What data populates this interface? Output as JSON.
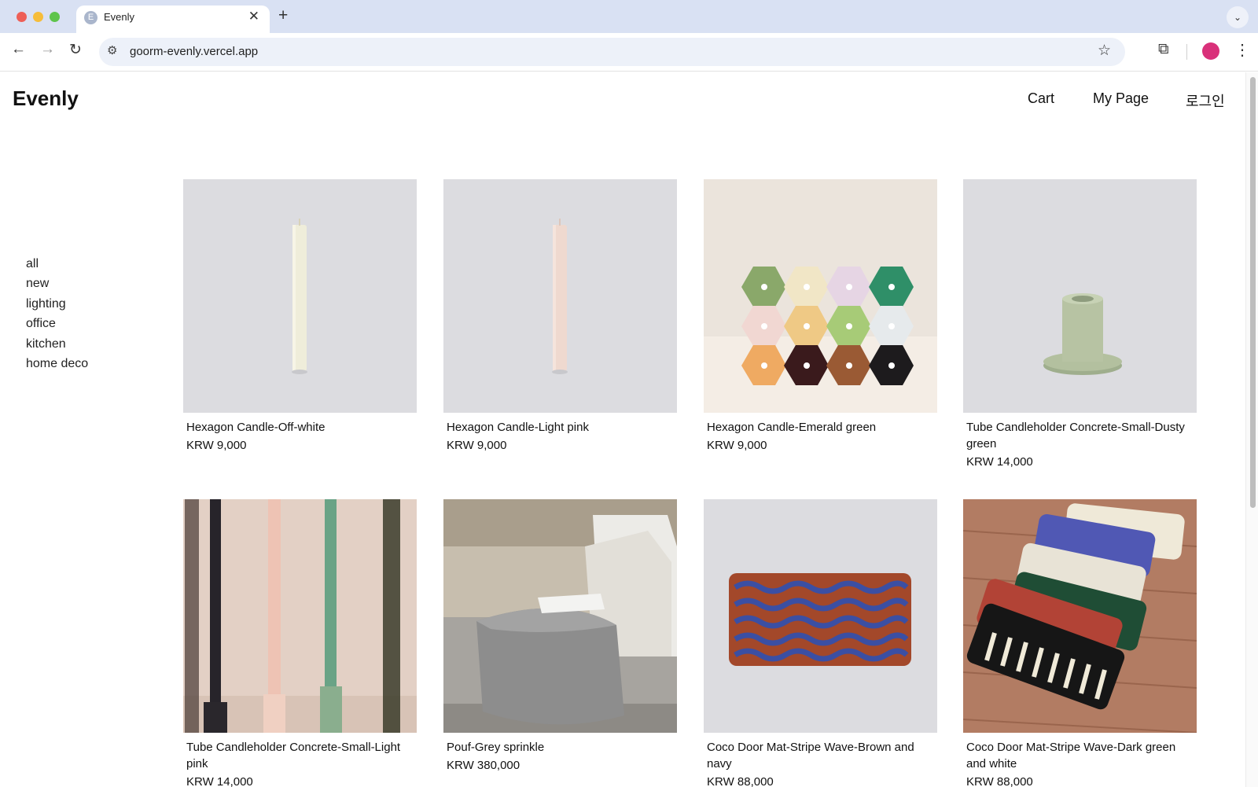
{
  "browser": {
    "tab_title": "Evenly",
    "tab_favicon_letter": "E",
    "url": "goorm-evenly.vercel.app"
  },
  "header": {
    "logo": "Evenly",
    "nav": {
      "cart": "Cart",
      "my_page": "My Page",
      "login": "로그인"
    }
  },
  "categories": [
    "all",
    "new",
    "lighting",
    "office",
    "kitchen",
    "home deco"
  ],
  "products": [
    {
      "title": "Hexagon Candle-Off-white",
      "price": "KRW 9,000"
    },
    {
      "title": "Hexagon Candle-Light pink",
      "price": "KRW 9,000"
    },
    {
      "title": "Hexagon Candle-Emerald green",
      "price": "KRW 9,000"
    },
    {
      "title": "Tube Candleholder Concrete-Small-Dusty green",
      "price": "KRW 14,000"
    },
    {
      "title": "Tube Candleholder Concrete-Small-Light pink",
      "price": "KRW 14,000"
    },
    {
      "title": "Pouf-Grey sprinkle",
      "price": "KRW 380,000"
    },
    {
      "title": "Coco Door Mat-Stripe Wave-Brown and navy",
      "price": "KRW 88,000"
    },
    {
      "title": "Coco Door Mat-Stripe Wave-Dark green and white",
      "price": "KRW 88,000"
    }
  ],
  "colors": {
    "product_bg": "#dcdce0",
    "profile_avatar": "#d9317a"
  },
  "icons": {
    "back": "arrow-left-icon",
    "forward": "arrow-right-icon",
    "reload": "reload-icon",
    "bookmark": "star-icon",
    "extensions": "puzzle-icon",
    "menu": "kebab-icon"
  }
}
